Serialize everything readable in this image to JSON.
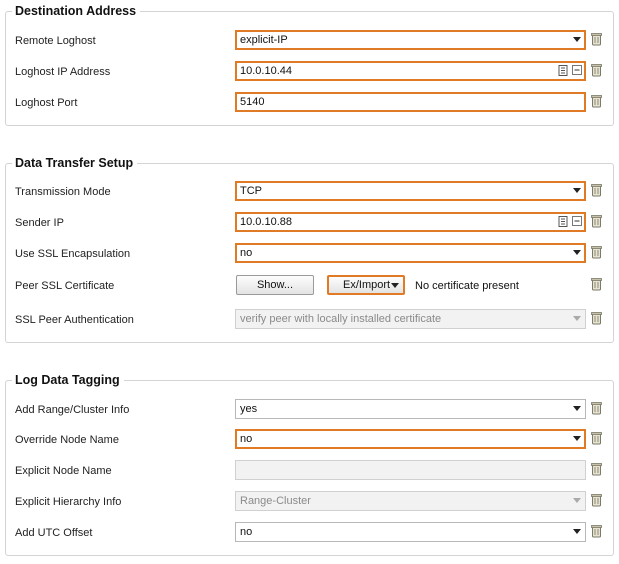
{
  "destination": {
    "title": "Destination Address",
    "remote_loghost": {
      "label": "Remote Loghost",
      "value": "explicit-IP"
    },
    "loghost_ip": {
      "label": "Loghost IP Address",
      "value": "10.0.10.44"
    },
    "loghost_port": {
      "label": "Loghost Port",
      "value": "5140"
    }
  },
  "transfer": {
    "title": "Data Transfer Setup",
    "transmission_mode": {
      "label": "Transmission Mode",
      "value": "TCP"
    },
    "sender_ip": {
      "label": "Sender IP",
      "value": "10.0.10.88"
    },
    "use_ssl": {
      "label": "Use SSL Encapsulation",
      "value": "no"
    },
    "peer_cert": {
      "label": "Peer SSL Certificate",
      "show_button": "Show...",
      "import_button": "Ex/Import",
      "status": "No certificate present"
    },
    "ssl_auth": {
      "label": "SSL Peer Authentication",
      "value": "verify peer with locally installed certificate"
    }
  },
  "tagging": {
    "title": "Log Data Tagging",
    "range_cluster": {
      "label": "Add Range/Cluster Info",
      "value": "yes"
    },
    "override_node": {
      "label": "Override Node Name",
      "value": "no"
    },
    "explicit_node": {
      "label": "Explicit Node Name",
      "value": ""
    },
    "explicit_hierarchy": {
      "label": "Explicit Hierarchy Info",
      "value": "Range-Cluster"
    },
    "utc_offset": {
      "label": "Add UTC Offset",
      "value": "no"
    }
  },
  "colors": {
    "highlight": "#e07a24",
    "border": "#d4d4d4",
    "disabled_text": "#8a8a8a"
  }
}
